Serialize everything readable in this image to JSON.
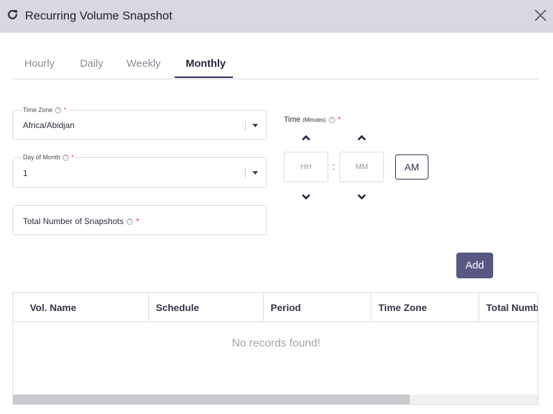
{
  "header": {
    "title": "Recurring Volume Snapshot",
    "refresh_icon": "refresh-icon",
    "close_icon": "close-icon"
  },
  "tabs": [
    {
      "label": "Hourly",
      "active": false
    },
    {
      "label": "Daily",
      "active": false
    },
    {
      "label": "Weekly",
      "active": false
    },
    {
      "label": "Monthly",
      "active": true
    }
  ],
  "form": {
    "time_zone": {
      "label": "Time Zone",
      "value": "Africa/Abidjan",
      "required": "*"
    },
    "day_of_month": {
      "label": "Day of Month",
      "value": "1",
      "required": "*"
    },
    "total_snapshots": {
      "label": "Total Number of Snapshots",
      "required": "*"
    }
  },
  "time": {
    "label": "Time",
    "sub_label": "(Minutes)",
    "required": "*",
    "hour_placeholder": "HH",
    "minute_placeholder": "MM",
    "separator": ":",
    "meridiem": "AM"
  },
  "add_button": "Add",
  "table": {
    "columns": [
      "Vol. Name",
      "Schedule",
      "Period",
      "Time Zone",
      "Total Numb"
    ],
    "empty_message": "No records found!"
  },
  "colors": {
    "header_bg": "#d8d8e1",
    "accent": "#2d2d52",
    "button_bg": "#585884",
    "required": "#e23b3b"
  }
}
